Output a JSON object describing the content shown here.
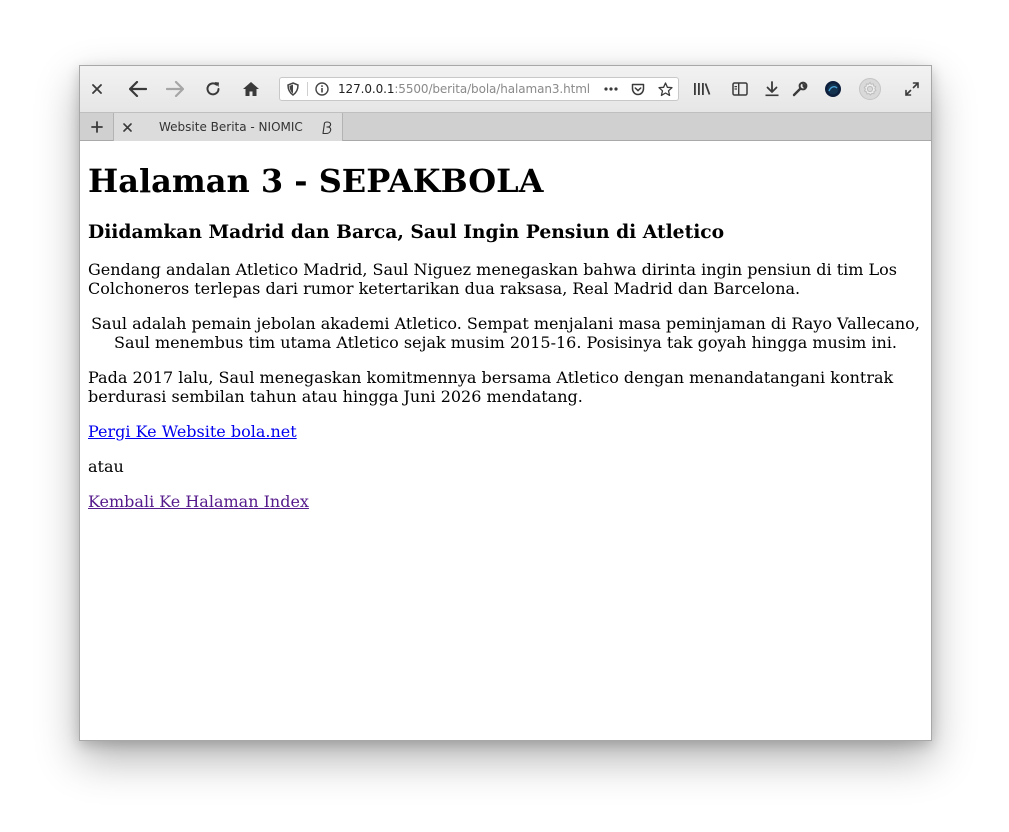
{
  "browser": {
    "url_host": "127.0.0.1",
    "url_rest": ":5500/berita/bola/halaman3.html",
    "tab_title": "Website Berita - NIOMIC",
    "icons": {
      "close": "close-icon",
      "back": "back-arrow-icon",
      "forward": "forward-arrow-icon",
      "reload": "reload-icon",
      "home": "home-icon",
      "tracking": "shield-icon",
      "site_info": "info-icon",
      "page_actions": "more-dots-icon",
      "pocket": "pocket-icon",
      "bookmark": "star-icon",
      "library": "library-icon",
      "sidebar": "sidebar-icon",
      "downloads": "download-icon",
      "devtools": "wrench-icon",
      "extension": "extension-icon",
      "settings": "gear-icon",
      "fullscreen": "fullscreen-icon",
      "new_tab": "plus-icon"
    }
  },
  "page": {
    "heading": "Halaman 3 - SEPAKBOLA",
    "subheading": "Diidamkan Madrid dan Barca, Saul Ingin Pensiun di Atletico",
    "paragraph_1": "Gendang andalan Atletico Madrid, Saul Niguez menegaskan bahwa dirinta ingin pensiun di tim Los Colchoneros terlepas dari rumor ketertarikan dua raksasa, Real Madrid dan Barcelona.",
    "paragraph_2": "Saul adalah pemain jebolan akademi Atletico. Sempat menjalani masa peminjaman di Rayo Vallecano, Saul menembus tim utama Atletico sejak musim 2015-16. Posisinya tak goyah hingga musim ini.",
    "paragraph_3": "Pada 2017 lalu, Saul menegaskan komitmennya bersama Atletico dengan menandatangani kontrak berdurasi sembilan tahun atau hingga Juni 2026 mendatang.",
    "link_external": "Pergi Ke Website bola.net",
    "separator_text": "atau",
    "link_index": "Kembali Ke Halaman Index"
  },
  "colors": {
    "link_unvisited": "#0000ee",
    "link_visited": "#551a8b",
    "toolbar_bg": "#e9e9e9",
    "tab_bar_bg": "#d0d0d0"
  }
}
